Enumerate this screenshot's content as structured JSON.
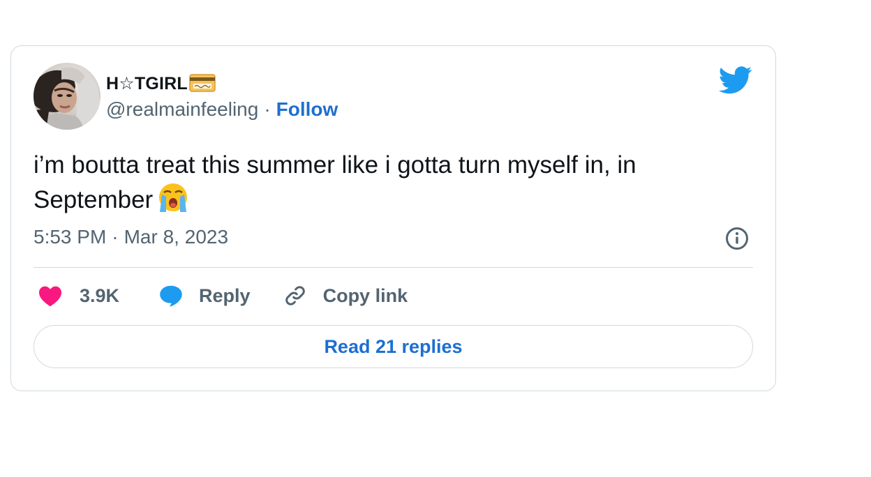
{
  "tweet": {
    "author": {
      "display_name": "H☆TGIRL",
      "name_badge_icon": "credit-card-icon",
      "handle": "@realmainfeeling",
      "separator": "·",
      "follow_label": "Follow"
    },
    "text": "i’m boutta treat this summer like i gotta turn myself in, in September",
    "text_emoji_icon": "loudly-crying-face-icon",
    "time": "5:53 PM",
    "time_separator": "·",
    "date": "Mar 8, 2023",
    "actions": {
      "like_count": "3.9K",
      "reply_label": "Reply",
      "copy_link_label": "Copy link"
    },
    "read_replies_label": "Read 21 replies"
  },
  "colors": {
    "accent": "#1d6fd1",
    "twitter_blue": "#1d9bf0",
    "like_pink": "#f91880",
    "secondary_text": "#536471",
    "border": "#cfd9de"
  }
}
